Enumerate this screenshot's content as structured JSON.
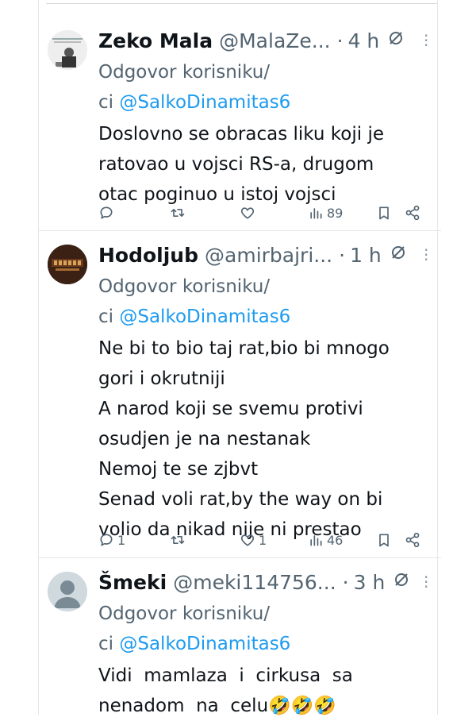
{
  "tweets": [
    {
      "name": "Zeko Mala",
      "handle": "@MalaZe...",
      "time": "4 h",
      "reply_prefix": "Odgovor korisniku/",
      "reply_prefix2": "ci ",
      "reply_to": "@SalkoDinamitas6",
      "text": "Doslovno se obracas liku koji je\nratovao u vojsci RS-a, drugom\notac poginuo u istoj vojsci",
      "reply_count": "",
      "retweet_count": "",
      "like_count": "",
      "views": "89"
    },
    {
      "name": "Hodoljub",
      "handle": "@amirbajri...",
      "time": "1 h",
      "reply_prefix": "Odgovor korisniku/",
      "reply_prefix2": "ci ",
      "reply_to": "@SalkoDinamitas6",
      "text": "Ne bi to bio taj rat,bio bi mnogo\ngori i okrutniji\nA narod koji se svemu protivi\nosudjen je na nestanak\nNemoj te se zjbvt\nSenad voli rat,by the way on bi\nvolio da nikad nije ni prestao",
      "reply_count": "1",
      "retweet_count": "",
      "like_count": "1",
      "views": "46"
    },
    {
      "name": "Šmeki",
      "handle": "@meki114756...",
      "time": "3 h",
      "reply_prefix": "Odgovor korisniku/",
      "reply_prefix2": "ci ",
      "reply_to": "@SalkoDinamitas6",
      "text": "Vidi  mamlaza  i  cirkusa  sa\nnenadom  na  celu🤣🤣🤣"
    }
  ],
  "colors": {
    "link": "#1d9bf0",
    "muted": "#536471",
    "text": "#0f1419"
  },
  "icons": [
    "reply-icon",
    "retweet-icon",
    "like-icon",
    "views-icon",
    "bookmark-icon",
    "share-icon",
    "grok-icon",
    "more-icon"
  ]
}
